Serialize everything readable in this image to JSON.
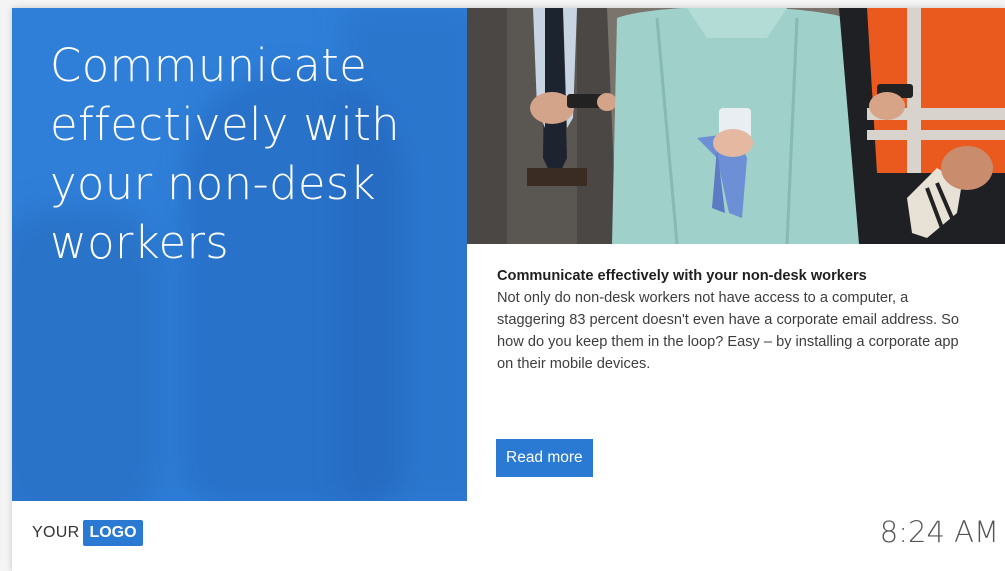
{
  "hero": {
    "title": "Communicate effectively with your non-desk workers"
  },
  "article": {
    "title": "Communicate effectively with your non-desk workers",
    "body": "Not only do non-desk workers not have access to a computer, a staggering 83 percent doesn't even have a corporate email address. So how do you keep them in the loop? Easy – by installing a corporate app on their mobile devices.",
    "read_more_label": "Read more"
  },
  "footer": {
    "logo_your": "YOUR",
    "logo_word": "LOGO",
    "time": "8:24 AM"
  },
  "colors": {
    "accent": "#2a7ad3",
    "hero_bg": "#2f7fd9"
  },
  "icons": {
    "photo": "workers-with-phones-photo"
  }
}
